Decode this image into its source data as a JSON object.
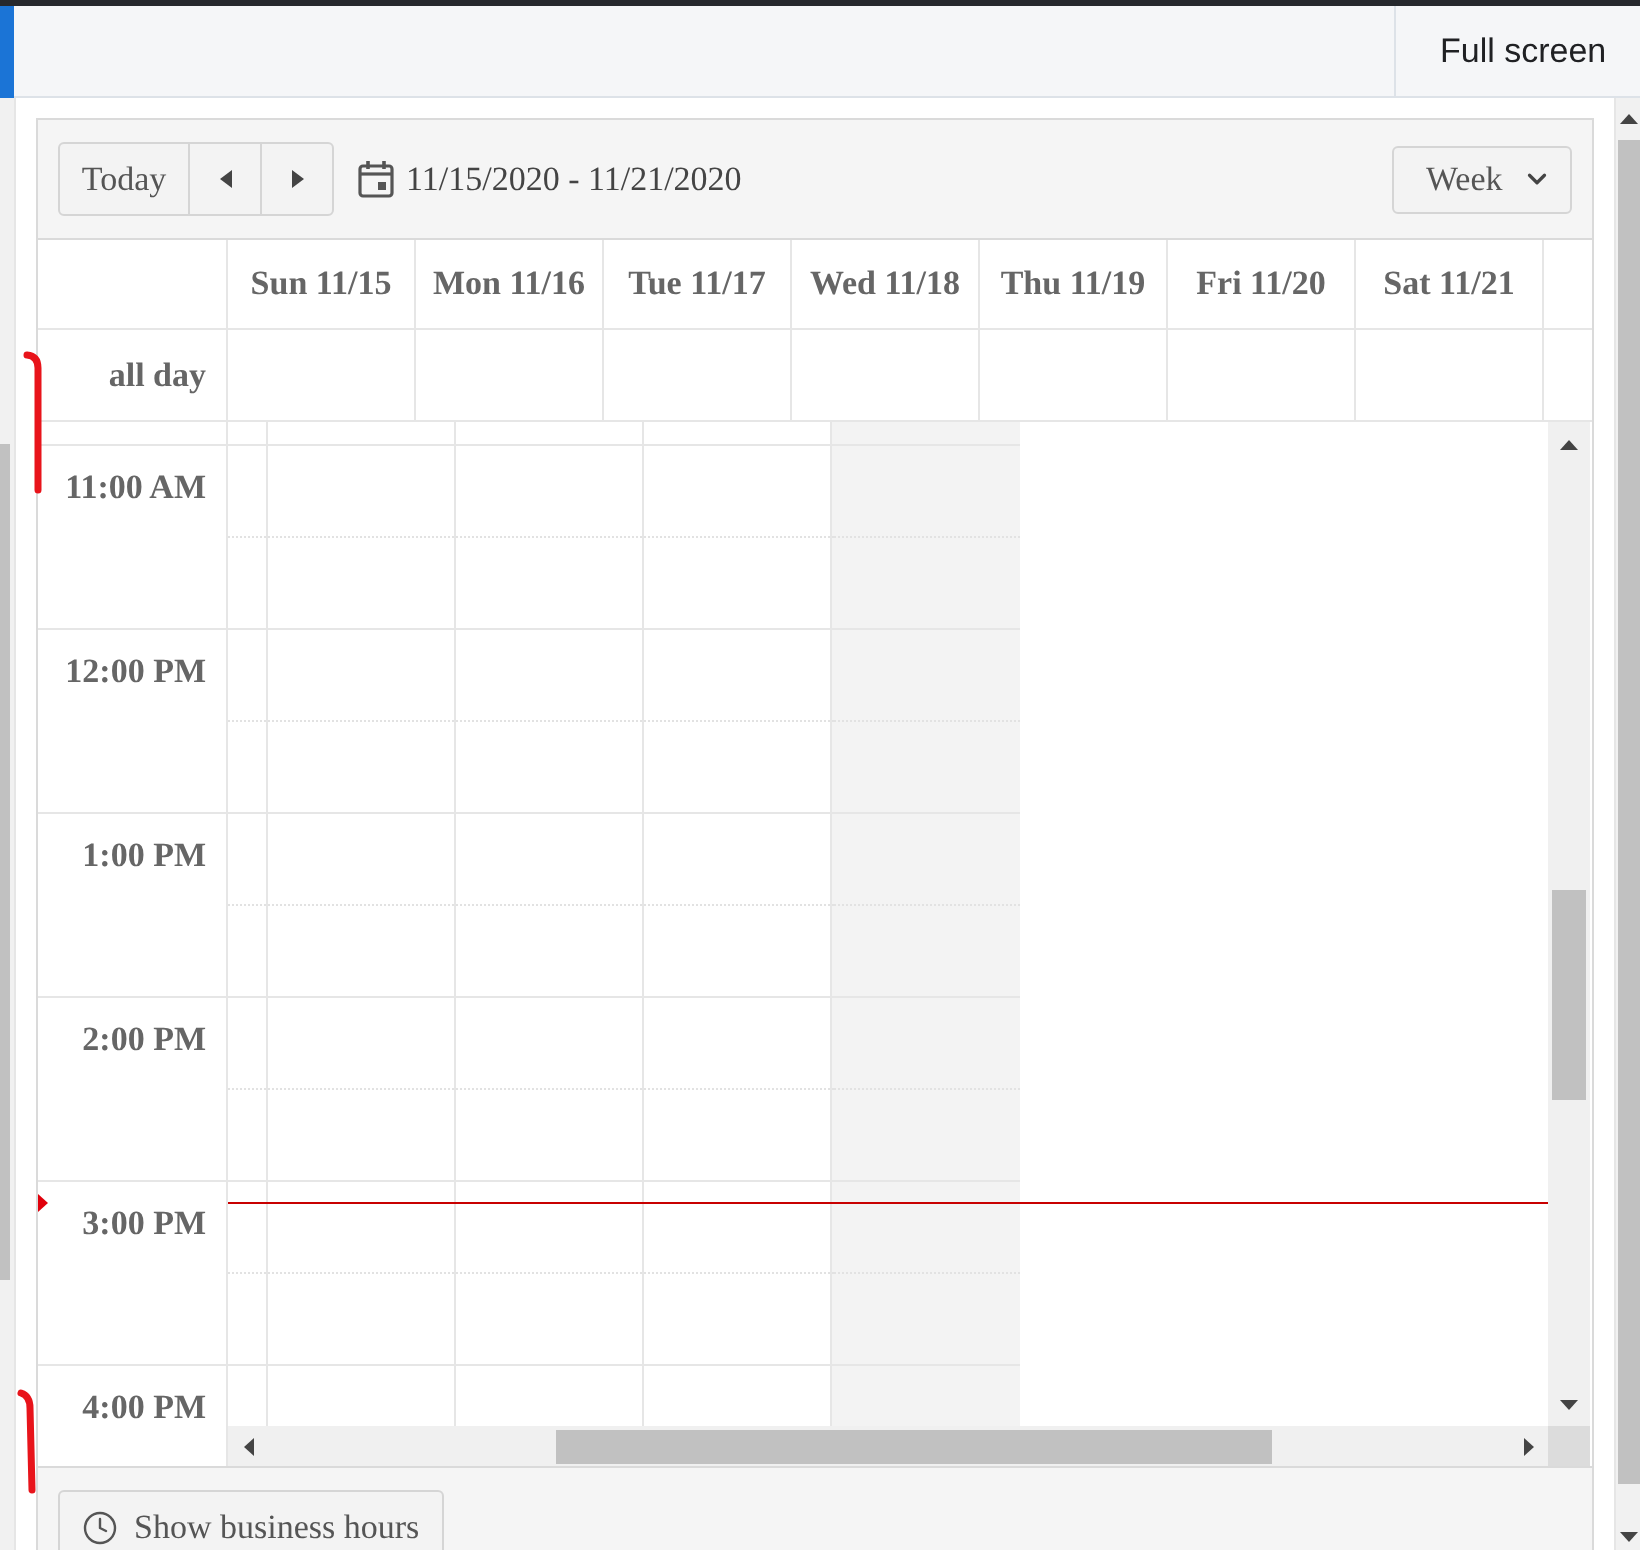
{
  "top_bar": {
    "full_screen_button": "Full screen"
  },
  "toolbar": {
    "today_button": "Today",
    "date_range": "11/15/2020 - 11/21/2020",
    "view_select": {
      "value": "Week"
    }
  },
  "header": {
    "days": [
      "Sun 11/15",
      "Mon 11/16",
      "Tue 11/17",
      "Wed 11/18",
      "Thu 11/19",
      "Fri 11/20",
      "Sat 11/21"
    ],
    "all_day_label": "all day"
  },
  "time_slots": [
    "11:00 AM",
    "12:00 PM",
    "1:00 PM",
    "2:00 PM",
    "3:00 PM",
    "4:00 PM"
  ],
  "grid_columns": [
    {
      "shaded": false
    },
    {
      "shaded": false
    },
    {
      "shaded": false
    },
    {
      "shaded": false
    },
    {
      "shaded": true
    }
  ],
  "current_time": {
    "shown": true
  },
  "footer": {
    "business_hours_button": "Show business hours"
  }
}
